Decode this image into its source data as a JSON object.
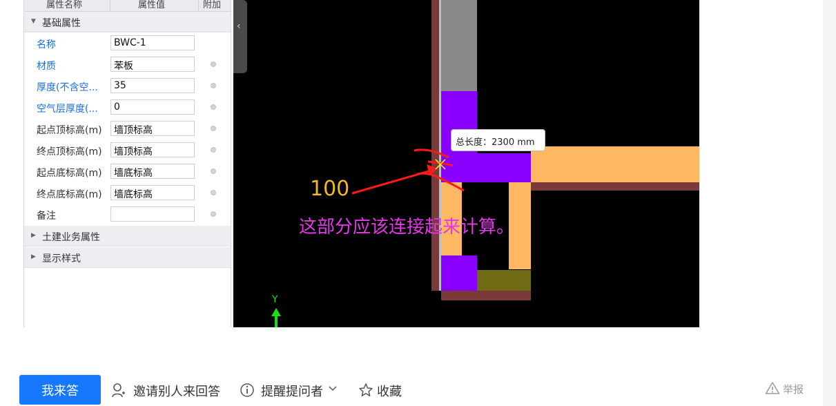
{
  "property_panel": {
    "header": {
      "col_name": "属性名称",
      "col_value": "属性值",
      "col_extra": "附加"
    },
    "sections": [
      {
        "label": "基础属性"
      },
      {
        "label": "土建业务属性"
      },
      {
        "label": "显示样式"
      }
    ],
    "rows": [
      {
        "name": "名称",
        "value": "BWC-1"
      },
      {
        "name": "材质",
        "value": "苯板"
      },
      {
        "name": "厚度(不含空...",
        "value": "35"
      },
      {
        "name": "空气层厚度(...",
        "value": "0"
      },
      {
        "name": "起点顶标高(m)",
        "value": "墙顶标高"
      },
      {
        "name": "终点顶标高(m)",
        "value": "墙顶标高"
      },
      {
        "name": "起点底标高(m)",
        "value": "墙底标高"
      },
      {
        "name": "终点底标高(m)",
        "value": "墙底标高"
      },
      {
        "name": "备注",
        "value": ""
      }
    ]
  },
  "viewport": {
    "collapse_icon": "chevron-left-icon",
    "tooltip": "总长度：2300 mm",
    "annotation_number": "100",
    "annotation_text": "这部分应该连接起来计算。",
    "axis_label": "Y",
    "colors": {
      "background": "#000000",
      "wall_gray": "#8a8a8a",
      "wall_orange": "#ffb862",
      "insulation_purple": "#8a00ff",
      "border_maroon": "#7a3a3a",
      "olive": "#6f6a14",
      "annotation_red": "#ff1a1a",
      "annotation_magenta": "#e238e6",
      "annotation_gold": "#f5b81c"
    }
  },
  "actions": {
    "answer_button": "我来答",
    "invite": "邀请别人来回答",
    "remind": "提醒提问者",
    "favorite": "收藏",
    "report": "举报"
  },
  "colors": {
    "primary": "#1677ff",
    "link_blue": "#1a6fdc"
  }
}
